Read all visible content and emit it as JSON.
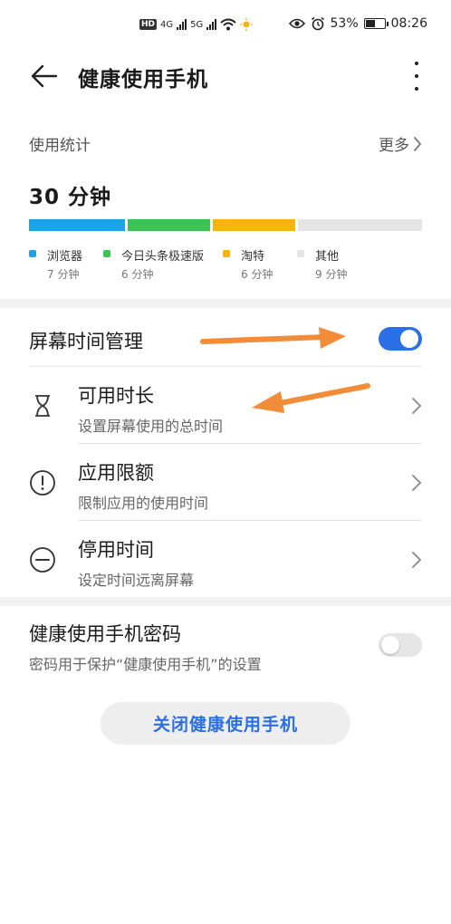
{
  "status_bar": {
    "hd": "HD",
    "sim1_tech": "4G",
    "sim2_tech": "5G",
    "battery_percent": "53%",
    "battery_level": 0.53,
    "time": "08:26"
  },
  "header": {
    "title": "健康使用手机"
  },
  "usage": {
    "label": "使用统计",
    "more": "更多",
    "total": "30 分钟",
    "categories": [
      {
        "name": "浏览器",
        "value": "7 分钟",
        "minutes": 7,
        "color": "#1aa3e8"
      },
      {
        "name": "今日头条极速版",
        "value": "6 分钟",
        "minutes": 6,
        "color": "#3cc354"
      },
      {
        "name": "淘特",
        "value": "6 分钟",
        "minutes": 6,
        "color": "#f5b50e"
      },
      {
        "name": "其他",
        "value": "9 分钟",
        "minutes": 9,
        "color": "#e5e5e5"
      }
    ]
  },
  "screen_time": {
    "label": "屏幕时间管理",
    "enabled": true,
    "items": [
      {
        "title": "可用时长",
        "subtitle": "设置屏幕使用的总时间",
        "icon": "hourglass-icon"
      },
      {
        "title": "应用限额",
        "subtitle": "限制应用的使用时间",
        "icon": "exclamation-circle-icon"
      },
      {
        "title": "停用时间",
        "subtitle": "设定时间远离屏幕",
        "icon": "minus-circle-icon"
      }
    ]
  },
  "password": {
    "title": "健康使用手机密码",
    "subtitle": "密码用于保护“健康使用手机”的设置",
    "enabled": false
  },
  "close_button": "关闭健康使用手机",
  "colors": {
    "accent": "#2b6fe6",
    "annotation_arrow": "#f28c38"
  }
}
